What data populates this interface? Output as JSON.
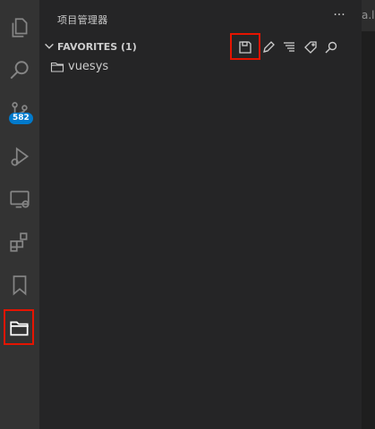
{
  "activity_bar": {
    "scm_badge": "582"
  },
  "sidebar": {
    "title": "项目管理器",
    "more": "···",
    "section": {
      "title": "FAVORITES (1)"
    },
    "items": [
      {
        "label": "vuesys"
      }
    ]
  },
  "editor": {
    "tab_fragment": "a.l"
  }
}
